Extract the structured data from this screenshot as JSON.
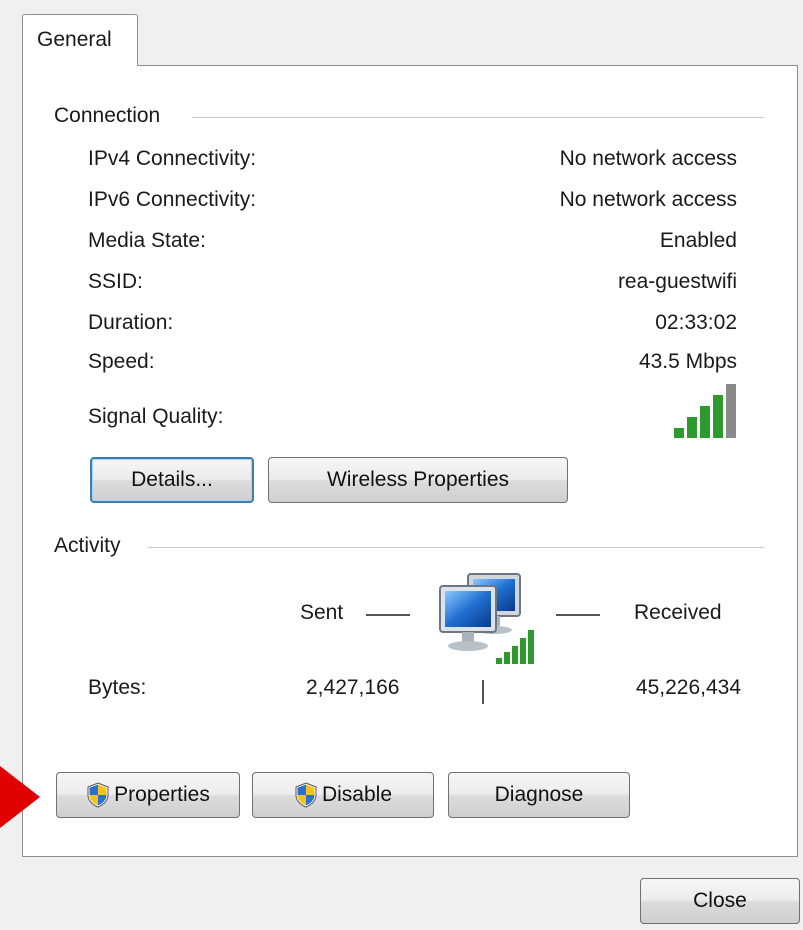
{
  "tab": {
    "label": "General"
  },
  "connection": {
    "heading": "Connection",
    "rows": [
      {
        "label": "IPv4 Connectivity:",
        "value": "No network access"
      },
      {
        "label": "IPv6 Connectivity:",
        "value": "No network access"
      },
      {
        "label": "Media State:",
        "value": "Enabled"
      },
      {
        "label": "SSID:",
        "value": "rea-guestwifi"
      },
      {
        "label": "Duration:",
        "value": "02:33:02"
      },
      {
        "label": "Speed:",
        "value": "43.5 Mbps"
      }
    ],
    "signal_label": "Signal Quality:",
    "signal_bars": 4,
    "signal_max": 5,
    "details_button": "Details...",
    "wireless_button": "Wireless Properties"
  },
  "activity": {
    "heading": "Activity",
    "sent_label": "Sent",
    "received_label": "Received",
    "bytes_label": "Bytes:",
    "bytes_sent": "2,427,166",
    "bytes_received": "45,226,434"
  },
  "buttons": {
    "properties": "Properties",
    "disable": "Disable",
    "diagnose": "Diagnose",
    "close": "Close"
  },
  "colors": {
    "signal_green": "#2e9a2e",
    "signal_gray": "#8a8a8a",
    "focus_border": "#3c7fb1",
    "arrow_red": "#e00000"
  }
}
